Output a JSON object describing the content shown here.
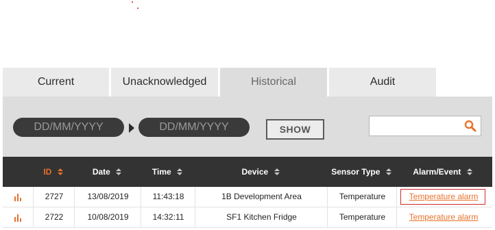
{
  "tabs": [
    {
      "label": "Current"
    },
    {
      "label": "Unacknowledged"
    },
    {
      "label": "Historical"
    },
    {
      "label": "Audit"
    }
  ],
  "filter": {
    "from_placeholder": "DD/MM/YYYY",
    "to_placeholder": "DD/MM/YYYY",
    "show_label": "SHOW",
    "search_value": ""
  },
  "columns": [
    {
      "label": "ID",
      "sorted": true
    },
    {
      "label": "Date",
      "sorted": false
    },
    {
      "label": "Time",
      "sorted": false
    },
    {
      "label": "Device",
      "sorted": false
    },
    {
      "label": "Sensor Type",
      "sorted": false
    },
    {
      "label": "Alarm/Event",
      "sorted": false
    }
  ],
  "rows": [
    {
      "id": "2727",
      "date": "13/08/2019",
      "time": "11:43:18",
      "device": "1B Development Area",
      "sensor_type": "Temperature",
      "alarm": "Temperature alarm"
    },
    {
      "id": "2722",
      "date": "10/08/2019",
      "time": "14:32:11",
      "device": "SF1 Kitchen Fridge",
      "sensor_type": "Temperature",
      "alarm": "Temperature alarm"
    }
  ],
  "colors": {
    "accent": "#e8712a",
    "header_bg": "#333333",
    "filter_bg": "#dddddd",
    "highlight": "#cf2a2a"
  },
  "icons": {
    "sort": "sort-icon",
    "chart": "bar-chart-icon",
    "search": "search-icon"
  }
}
